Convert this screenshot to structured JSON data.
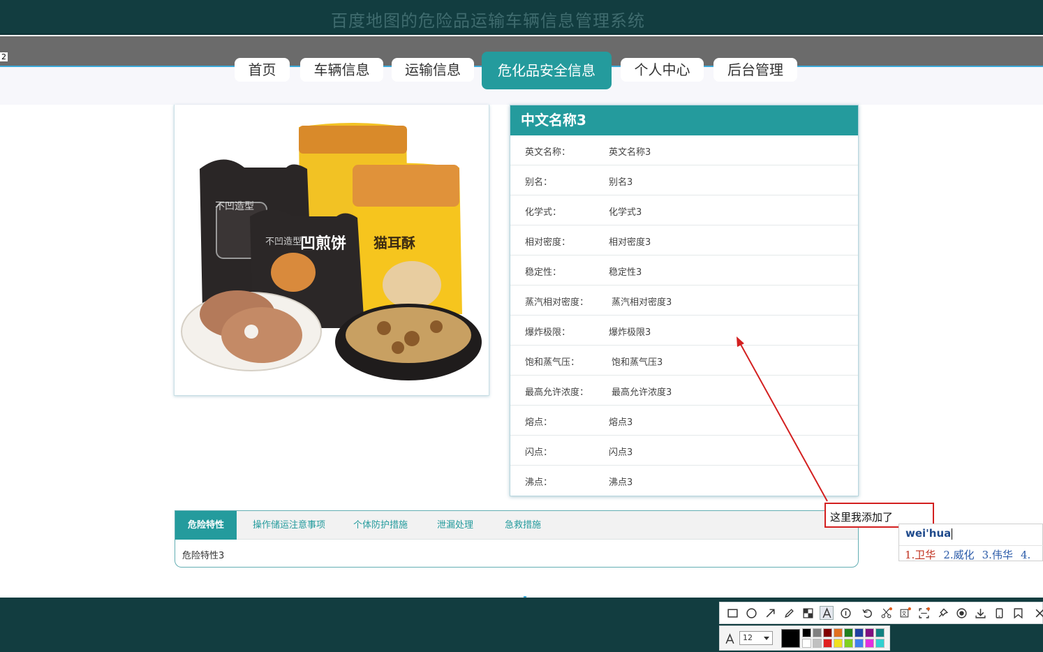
{
  "header": {
    "title": "百度地图的危险品运输车辆信息管理系统"
  },
  "band_marker": "2",
  "nav": {
    "items": [
      {
        "label": "首页",
        "active": false
      },
      {
        "label": "车辆信息",
        "active": false
      },
      {
        "label": "运输信息",
        "active": false
      },
      {
        "label": "危化品安全信息",
        "active": true
      },
      {
        "label": "个人中心",
        "active": false
      },
      {
        "label": "后台管理",
        "active": false
      }
    ]
  },
  "product": {
    "image_icon": "snack-product-photo"
  },
  "detail": {
    "title": "中文名称3",
    "rows": [
      {
        "label": "英文名称：",
        "value": "英文名称3"
      },
      {
        "label": "别名：",
        "value": "别名3"
      },
      {
        "label": "化学式：",
        "value": "化学式3"
      },
      {
        "label": "相对密度：",
        "value": "相对密度3"
      },
      {
        "label": "稳定性：",
        "value": "稳定性3"
      },
      {
        "label": "蒸汽相对密度：",
        "value": "蒸汽相对密度3"
      },
      {
        "label": "爆炸极限：",
        "value": "爆炸极限3"
      },
      {
        "label": "饱和蒸气压：",
        "value": "饱和蒸气压3"
      },
      {
        "label": "最高允许浓度：",
        "value": "最高允许浓度3"
      },
      {
        "label": "熔点：",
        "value": "熔点3"
      },
      {
        "label": "闪点：",
        "value": "闪点3"
      },
      {
        "label": "沸点：",
        "value": "沸点3"
      }
    ]
  },
  "tabs": {
    "items": [
      {
        "label": "危险特性",
        "active": true
      },
      {
        "label": "操作储运注意事项",
        "active": false
      },
      {
        "label": "个体防护措施",
        "active": false
      },
      {
        "label": "泄漏处理",
        "active": false
      },
      {
        "label": "急救措施",
        "active": false
      }
    ],
    "content": "危险特性3"
  },
  "annotation": {
    "text": "这里我添加了",
    "color": "#d32020"
  },
  "ime": {
    "input": "wei'hua",
    "candidates": [
      "1.卫华",
      "2.威化",
      "3.伟华",
      "4."
    ]
  },
  "toolbar": {
    "font_size": "12",
    "tools": [
      "rectangle-icon",
      "ellipse-icon",
      "arrow-icon",
      "pencil-icon",
      "mosaic-icon",
      "text-icon",
      "number-icon",
      "undo-icon",
      "crop-icon",
      "ocr-icon",
      "scan-icon",
      "pin-icon",
      "record-icon",
      "download-icon",
      "phone-icon",
      "bookmark-icon",
      "close-icon"
    ],
    "current_color": "#000000",
    "palette": [
      "#000000",
      "#808080",
      "#800000",
      "#e07020",
      "#208020",
      "#2040a0",
      "#801080",
      "#108080",
      "#ffffff",
      "#c0c0c0",
      "#e02020",
      "#f0e020",
      "#80d020",
      "#4080f0",
      "#e030e0",
      "#30d0d0"
    ]
  },
  "colors": {
    "primary": "#249b9d",
    "dark": "#123d40",
    "band": "#6b6b6b"
  }
}
